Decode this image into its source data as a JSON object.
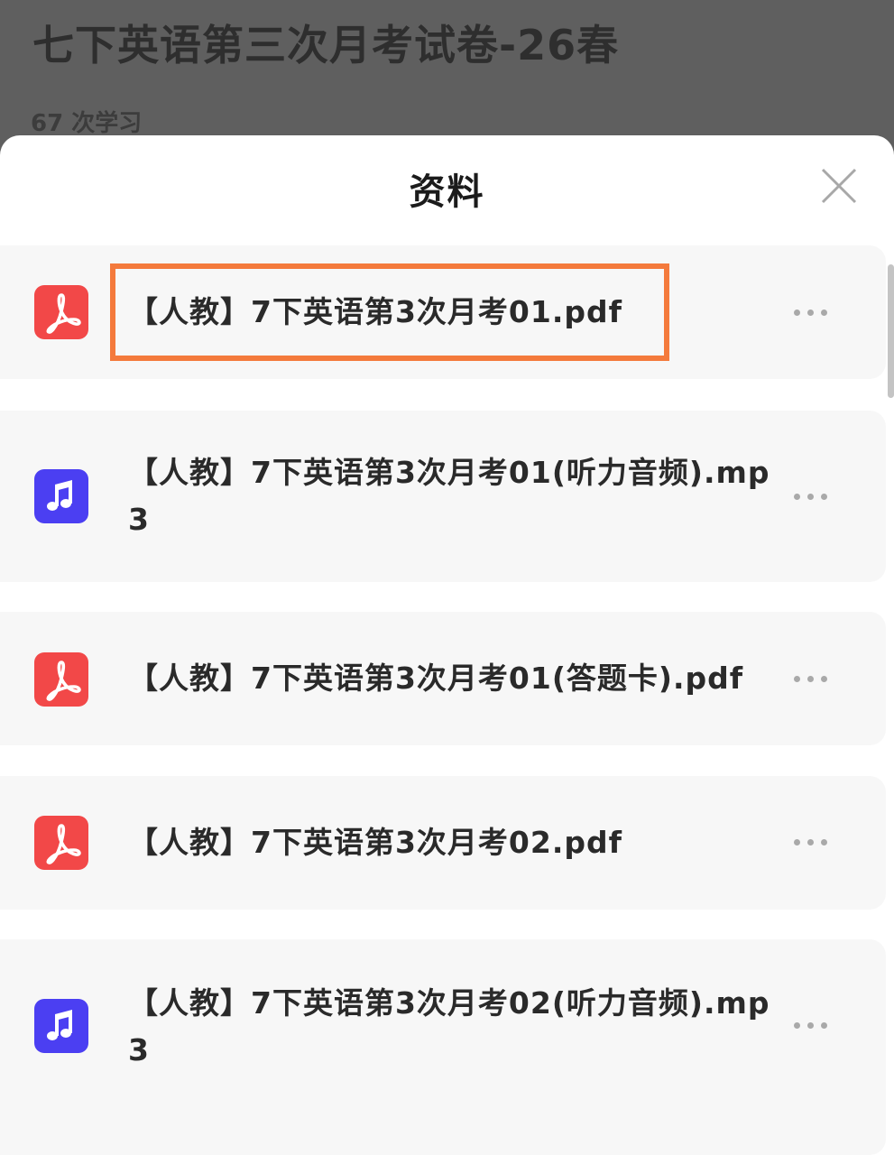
{
  "background_page": {
    "title": "七下英语第三次月考试卷-26春",
    "study_count": "67 次学习"
  },
  "sheet": {
    "title": "资料",
    "close_icon": "close-icon",
    "more_icon": "more-dots-icon",
    "files": [
      {
        "name": "【人教】7下英语第3次月考01.pdf",
        "type": "pdf",
        "icon": "pdf-icon",
        "highlighted": true
      },
      {
        "name": "【人教】7下英语第3次月考01(听力音频).mp3",
        "type": "mp3",
        "icon": "music-note-icon",
        "highlighted": false
      },
      {
        "name": "【人教】7下英语第3次月考01(答题卡).pdf",
        "type": "pdf",
        "icon": "pdf-icon",
        "highlighted": false
      },
      {
        "name": "【人教】7下英语第3次月考02.pdf",
        "type": "pdf",
        "icon": "pdf-icon",
        "highlighted": false
      },
      {
        "name": "【人教】7下英语第3次月考02(听力音频).mp3",
        "type": "mp3",
        "icon": "music-note-icon",
        "highlighted": false
      }
    ]
  },
  "colors": {
    "pdf_icon_bg": "#f24848",
    "mp3_icon_bg": "#4b3ff2",
    "highlight_border": "#f47a3c",
    "backdrop": "#5f5f5f"
  }
}
